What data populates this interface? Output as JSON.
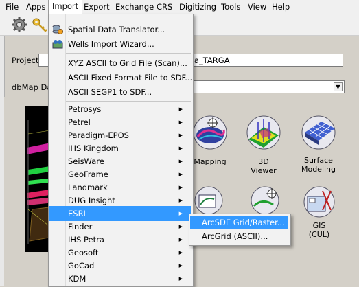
{
  "menubar": {
    "items": [
      "File",
      "Apps",
      "Import",
      "Export",
      "Exchange",
      "CRS",
      "Digitizing",
      "Tools",
      "View",
      "Help"
    ]
  },
  "main": {
    "project_label": "Project",
    "project_value": "a_TARGA",
    "dbmap_label": "dbMap Da",
    "dbmap_value": ""
  },
  "tools": {
    "mapping": "Mapping",
    "viewer3d": "3D Viewer",
    "surface_line1": "Surface",
    "surface_line2": "Modeling",
    "gis_line1": "GIS",
    "gis_line2": "(CUL)"
  },
  "import_menu": {
    "items": [
      {
        "label": "Spatial Data Translator...",
        "submenu": false,
        "icon": "db-translate-icon"
      },
      {
        "label": "Wells Import Wizard...",
        "submenu": false,
        "icon": "wells-icon"
      },
      {
        "label": "XYZ ASCII to Grid File (Scan)...",
        "submenu": false
      },
      {
        "label": "ASCII Fixed Format File to SDF...",
        "submenu": false
      },
      {
        "label": "ASCII SEGP1 to SDF...",
        "submenu": false
      },
      {
        "label": "Petrosys",
        "submenu": true
      },
      {
        "label": "Petrel",
        "submenu": true
      },
      {
        "label": "Paradigm-EPOS",
        "submenu": true
      },
      {
        "label": "IHS Kingdom",
        "submenu": true
      },
      {
        "label": "SeisWare",
        "submenu": true
      },
      {
        "label": "GeoFrame",
        "submenu": true
      },
      {
        "label": "Landmark",
        "submenu": true
      },
      {
        "label": "DUG Insight",
        "submenu": true
      },
      {
        "label": "ESRI",
        "submenu": true,
        "highlighted": true
      },
      {
        "label": "Finder",
        "submenu": true
      },
      {
        "label": "IHS Petra",
        "submenu": true
      },
      {
        "label": "Geosoft",
        "submenu": true
      },
      {
        "label": "GoCad",
        "submenu": true
      },
      {
        "label": "KDM",
        "submenu": true
      }
    ]
  },
  "esri_submenu": {
    "items": [
      {
        "label": "ArcSDE Grid/Raster...",
        "highlighted": true
      },
      {
        "label": "ArcGrid (ASCII)..."
      }
    ]
  },
  "colors": {
    "highlight": "#3399ff",
    "menu_bg": "#f2f2f2"
  }
}
